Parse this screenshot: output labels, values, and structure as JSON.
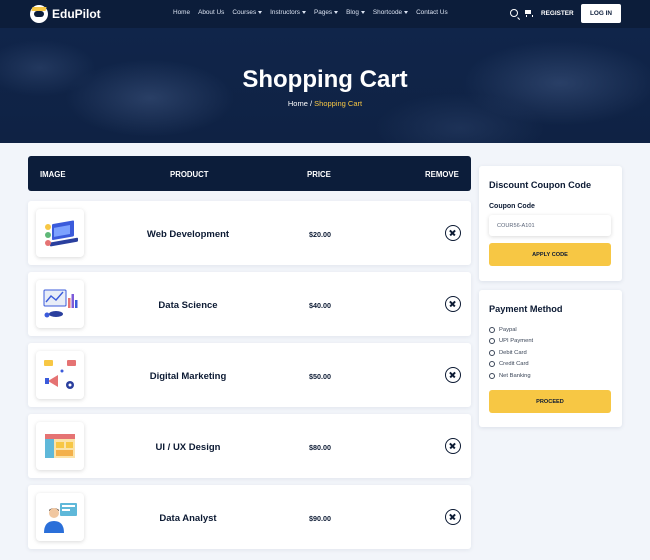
{
  "header": {
    "logo_text": "EduPilot",
    "nav": [
      {
        "label": "Home",
        "dropdown": false
      },
      {
        "label": "About Us",
        "dropdown": false
      },
      {
        "label": "Courses",
        "dropdown": true
      },
      {
        "label": "Instructors",
        "dropdown": true
      },
      {
        "label": "Pages",
        "dropdown": true
      },
      {
        "label": "Blog",
        "dropdown": true
      },
      {
        "label": "Shortcode",
        "dropdown": true
      },
      {
        "label": "Contact Us",
        "dropdown": false
      }
    ],
    "register_label": "REGISTER",
    "login_label": "LOG IN"
  },
  "hero": {
    "title": "Shopping Cart",
    "breadcrumb_home": "Home",
    "breadcrumb_separator": " / ",
    "breadcrumb_current": "Shopping Cart"
  },
  "cart": {
    "columns": {
      "image": "IMAGE",
      "product": "PRODUCT",
      "price": "PRICE",
      "remove": "REMOVE"
    },
    "items": [
      {
        "product": "Web Development",
        "price": "$20.00",
        "thumb_icon": "laptop-icon"
      },
      {
        "product": "Data Science",
        "price": "$40.00",
        "thumb_icon": "data-chart-icon"
      },
      {
        "product": "Digital Marketing",
        "price": "$50.00",
        "thumb_icon": "megaphone-icon"
      },
      {
        "product": "UI / UX Design",
        "price": "$80.00",
        "thumb_icon": "layout-icon"
      },
      {
        "product": "Data Analyst",
        "price": "$90.00",
        "thumb_icon": "analyst-person-icon"
      }
    ]
  },
  "coupon": {
    "title": "Discount Coupon Code",
    "field_label": "Coupon Code",
    "input_value": "COUR56-A101",
    "button_label": "APPLY CODE"
  },
  "payment": {
    "title": "Payment Method",
    "options": [
      "Paypal",
      "UPI Payment",
      "Debit Card",
      "Credit Card",
      "Net Banking"
    ],
    "button_label": "PROCEED"
  },
  "colors": {
    "navy": "#0c1d3a",
    "accent_yellow": "#f7c744",
    "page_bg": "#f2f5fa"
  }
}
